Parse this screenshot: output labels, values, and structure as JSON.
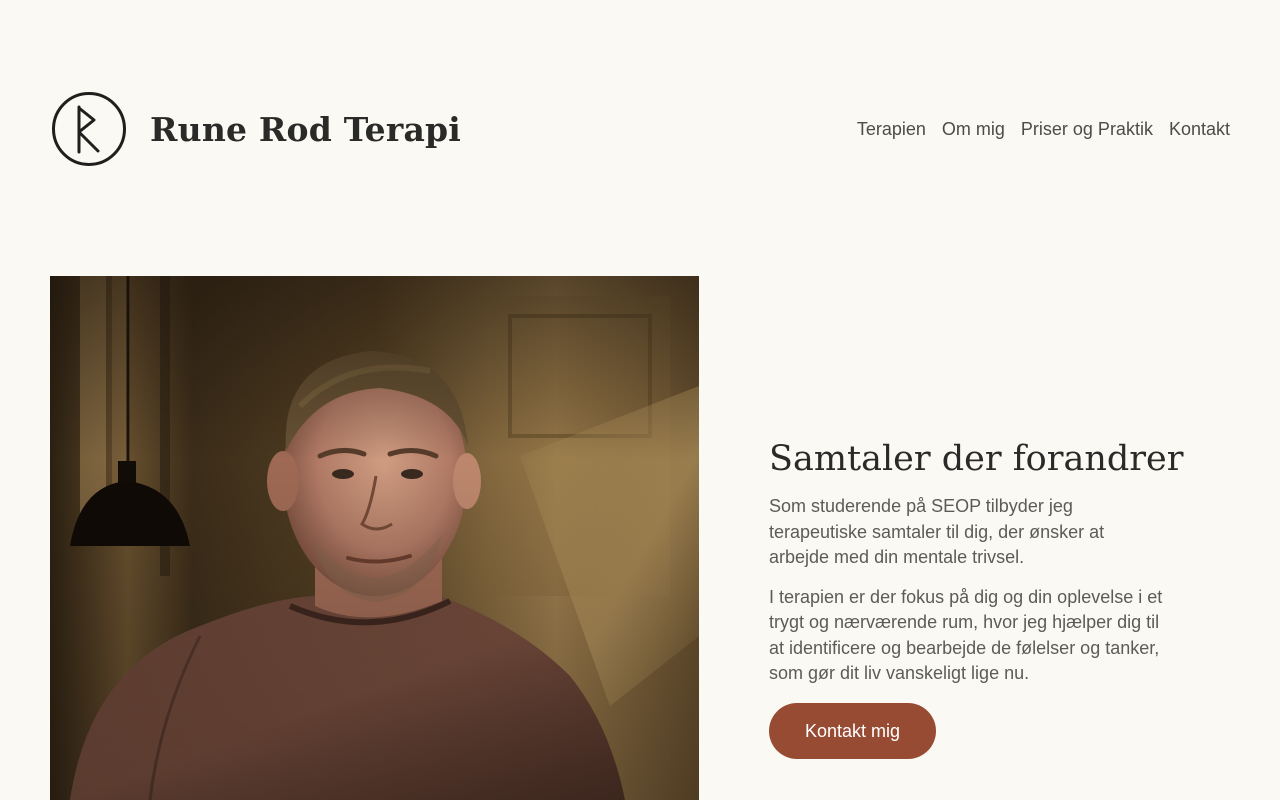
{
  "header": {
    "site_title": "Rune Rod Terapi",
    "logo_icon": "rune-circle-logo-icon"
  },
  "nav": {
    "items": [
      {
        "label": "Terapien"
      },
      {
        "label": "Om mig"
      },
      {
        "label": "Priser og Praktik"
      },
      {
        "label": "Kontakt"
      }
    ]
  },
  "hero": {
    "image": "portrait-photo",
    "heading": "Samtaler der forandrer",
    "paragraphs": [
      "Som studerende på SEOP tilbyder jeg terapeutiske samtaler til dig, der ønsker at arbejde med din mentale trivsel.",
      "I terapien er der fokus på dig og din oplevelse i et trygt og nærværende rum, hvor jeg hjælper dig til at identificere og bearbejde de følelser og tanker, som gør dit liv vanskeligt lige nu."
    ],
    "cta_label": "Kontakt mig"
  },
  "colors": {
    "background": "#faf9f4",
    "text": "#2a2a28",
    "muted_text": "#5d5b55",
    "accent": "#974b33"
  }
}
